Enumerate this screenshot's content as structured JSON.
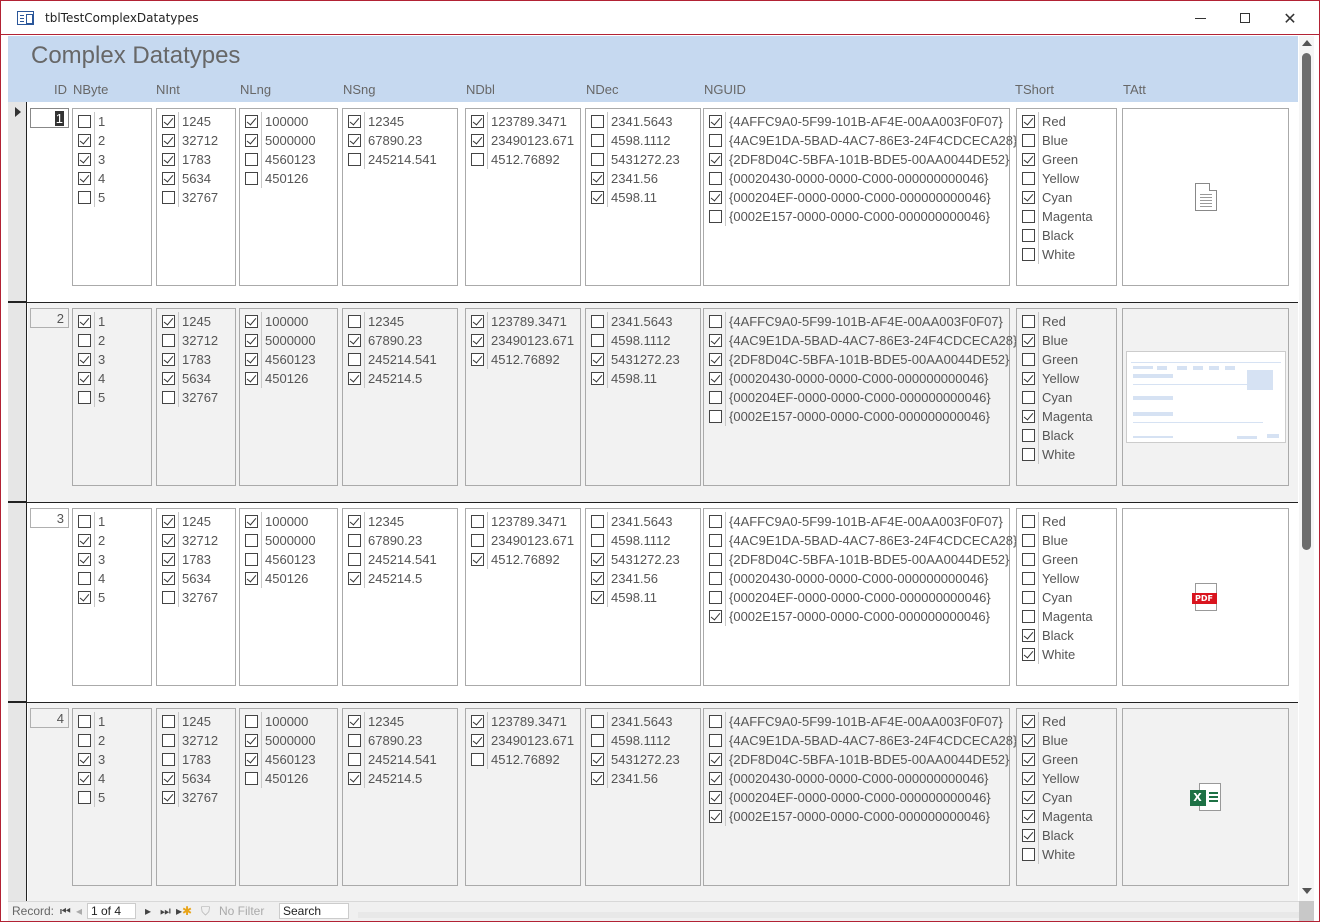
{
  "window": {
    "title": "tblTestComplexDatatypes",
    "controls": [
      "minimize",
      "maximize",
      "close"
    ]
  },
  "form": {
    "title": "Complex Datatypes",
    "columns": [
      "ID",
      "NByte",
      "NInt",
      "NLng",
      "NSng",
      "NDbl",
      "NDec",
      "NGUID",
      "TShort",
      "TAtt"
    ]
  },
  "records": [
    {
      "id": "1",
      "nbyte": [
        {
          "v": "1",
          "c": false
        },
        {
          "v": "2",
          "c": true
        },
        {
          "v": "3",
          "c": true
        },
        {
          "v": "4",
          "c": true
        },
        {
          "v": "5",
          "c": false
        }
      ],
      "nint": [
        {
          "v": "1245",
          "c": true
        },
        {
          "v": "32712",
          "c": true
        },
        {
          "v": "1783",
          "c": true
        },
        {
          "v": "5634",
          "c": true
        },
        {
          "v": "32767",
          "c": false
        }
      ],
      "nlng": [
        {
          "v": "100000",
          "c": true
        },
        {
          "v": "5000000",
          "c": true
        },
        {
          "v": "4560123",
          "c": false
        },
        {
          "v": "450126",
          "c": false
        }
      ],
      "nsng": [
        {
          "v": "12345",
          "c": true
        },
        {
          "v": "67890.23",
          "c": true
        },
        {
          "v": "245214.541",
          "c": false
        }
      ],
      "ndbl": [
        {
          "v": "123789.3471",
          "c": true
        },
        {
          "v": "23490123.671",
          "c": true
        },
        {
          "v": "4512.76892",
          "c": false
        }
      ],
      "ndec": [
        {
          "v": "2341.5643",
          "c": false
        },
        {
          "v": "4598.1112",
          "c": false
        },
        {
          "v": "5431272.23",
          "c": false
        },
        {
          "v": "2341.56",
          "c": true
        },
        {
          "v": "4598.11",
          "c": true
        }
      ],
      "nguid": [
        {
          "v": "{4AFFC9A0-5F99-101B-AF4E-00AA003F0F07}",
          "c": true
        },
        {
          "v": "{4AC9E1DA-5BAD-4AC7-86E3-24F4CDCECA28}",
          "c": false
        },
        {
          "v": "{2DF8D04C-5BFA-101B-BDE5-00AA0044DE52}",
          "c": true
        },
        {
          "v": "{00020430-0000-0000-C000-000000000046}",
          "c": false
        },
        {
          "v": "{000204EF-0000-0000-C000-000000000046}",
          "c": true
        },
        {
          "v": "{0002E157-0000-0000-C000-000000000046}",
          "c": false
        }
      ],
      "tshort": [
        {
          "v": "Red",
          "c": true
        },
        {
          "v": "Blue",
          "c": false
        },
        {
          "v": "Green",
          "c": true
        },
        {
          "v": "Yellow",
          "c": false
        },
        {
          "v": "Cyan",
          "c": true
        },
        {
          "v": "Magenta",
          "c": false
        },
        {
          "v": "Black",
          "c": false
        },
        {
          "v": "White",
          "c": false
        }
      ],
      "tatt": "generic-document-icon"
    },
    {
      "id": "2",
      "nbyte": [
        {
          "v": "1",
          "c": true
        },
        {
          "v": "2",
          "c": false
        },
        {
          "v": "3",
          "c": true
        },
        {
          "v": "4",
          "c": true
        },
        {
          "v": "5",
          "c": false
        }
      ],
      "nint": [
        {
          "v": "1245",
          "c": true
        },
        {
          "v": "32712",
          "c": false
        },
        {
          "v": "1783",
          "c": true
        },
        {
          "v": "5634",
          "c": true
        },
        {
          "v": "32767",
          "c": false
        }
      ],
      "nlng": [
        {
          "v": "100000",
          "c": true
        },
        {
          "v": "5000000",
          "c": true
        },
        {
          "v": "4560123",
          "c": true
        },
        {
          "v": "450126",
          "c": true
        }
      ],
      "nsng": [
        {
          "v": "12345",
          "c": false
        },
        {
          "v": "67890.23",
          "c": true
        },
        {
          "v": "245214.541",
          "c": false
        },
        {
          "v": "245214.5",
          "c": true
        }
      ],
      "ndbl": [
        {
          "v": "123789.3471",
          "c": true
        },
        {
          "v": "23490123.671",
          "c": true
        },
        {
          "v": "4512.76892",
          "c": true
        }
      ],
      "ndec": [
        {
          "v": "2341.5643",
          "c": false
        },
        {
          "v": "4598.1112",
          "c": false
        },
        {
          "v": "5431272.23",
          "c": true
        },
        {
          "v": "4598.11",
          "c": true
        }
      ],
      "nguid": [
        {
          "v": "{4AFFC9A0-5F99-101B-AF4E-00AA003F0F07}",
          "c": false
        },
        {
          "v": "{4AC9E1DA-5BAD-4AC7-86E3-24F4CDCECA28}",
          "c": true
        },
        {
          "v": "{2DF8D04C-5BFA-101B-BDE5-00AA0044DE52}",
          "c": true
        },
        {
          "v": "{00020430-0000-0000-C000-000000000046}",
          "c": true
        },
        {
          "v": "{000204EF-0000-0000-C000-000000000046}",
          "c": false
        },
        {
          "v": "{0002E157-0000-0000-C000-000000000046}",
          "c": false
        }
      ],
      "tshort": [
        {
          "v": "Red",
          "c": false
        },
        {
          "v": "Blue",
          "c": true
        },
        {
          "v": "Green",
          "c": false
        },
        {
          "v": "Yellow",
          "c": true
        },
        {
          "v": "Cyan",
          "c": false
        },
        {
          "v": "Magenta",
          "c": true
        },
        {
          "v": "Black",
          "c": false
        },
        {
          "v": "White",
          "c": false
        }
      ],
      "tatt": "screenshot-thumbnail"
    },
    {
      "id": "3",
      "nbyte": [
        {
          "v": "1",
          "c": false
        },
        {
          "v": "2",
          "c": true
        },
        {
          "v": "3",
          "c": true
        },
        {
          "v": "4",
          "c": false
        },
        {
          "v": "5",
          "c": true
        }
      ],
      "nint": [
        {
          "v": "1245",
          "c": true
        },
        {
          "v": "32712",
          "c": true
        },
        {
          "v": "1783",
          "c": true
        },
        {
          "v": "5634",
          "c": true
        },
        {
          "v": "32767",
          "c": false
        }
      ],
      "nlng": [
        {
          "v": "100000",
          "c": true
        },
        {
          "v": "5000000",
          "c": false
        },
        {
          "v": "4560123",
          "c": false
        },
        {
          "v": "450126",
          "c": true
        }
      ],
      "nsng": [
        {
          "v": "12345",
          "c": true
        },
        {
          "v": "67890.23",
          "c": false
        },
        {
          "v": "245214.541",
          "c": false
        },
        {
          "v": "245214.5",
          "c": true
        }
      ],
      "ndbl": [
        {
          "v": "123789.3471",
          "c": false
        },
        {
          "v": "23490123.671",
          "c": false
        },
        {
          "v": "4512.76892",
          "c": true
        }
      ],
      "ndec": [
        {
          "v": "2341.5643",
          "c": false
        },
        {
          "v": "4598.1112",
          "c": false
        },
        {
          "v": "5431272.23",
          "c": true
        },
        {
          "v": "2341.56",
          "c": true
        },
        {
          "v": "4598.11",
          "c": true
        }
      ],
      "nguid": [
        {
          "v": "{4AFFC9A0-5F99-101B-AF4E-00AA003F0F07}",
          "c": false
        },
        {
          "v": "{4AC9E1DA-5BAD-4AC7-86E3-24F4CDCECA28}",
          "c": false
        },
        {
          "v": "{2DF8D04C-5BFA-101B-BDE5-00AA0044DE52}",
          "c": false
        },
        {
          "v": "{00020430-0000-0000-C000-000000000046}",
          "c": false
        },
        {
          "v": "{000204EF-0000-0000-C000-000000000046}",
          "c": false
        },
        {
          "v": "{0002E157-0000-0000-C000-000000000046}",
          "c": true
        }
      ],
      "tshort": [
        {
          "v": "Red",
          "c": false
        },
        {
          "v": "Blue",
          "c": false
        },
        {
          "v": "Green",
          "c": false
        },
        {
          "v": "Yellow",
          "c": false
        },
        {
          "v": "Cyan",
          "c": false
        },
        {
          "v": "Magenta",
          "c": false
        },
        {
          "v": "Black",
          "c": true
        },
        {
          "v": "White",
          "c": true
        }
      ],
      "tatt": "pdf-icon",
      "tatt_label": "PDF"
    },
    {
      "id": "4",
      "nbyte": [
        {
          "v": "1",
          "c": false
        },
        {
          "v": "2",
          "c": false
        },
        {
          "v": "3",
          "c": true
        },
        {
          "v": "4",
          "c": true
        },
        {
          "v": "5",
          "c": false
        }
      ],
      "nint": [
        {
          "v": "1245",
          "c": false
        },
        {
          "v": "32712",
          "c": false
        },
        {
          "v": "1783",
          "c": false
        },
        {
          "v": "5634",
          "c": true
        },
        {
          "v": "32767",
          "c": true
        }
      ],
      "nlng": [
        {
          "v": "100000",
          "c": false
        },
        {
          "v": "5000000",
          "c": true
        },
        {
          "v": "4560123",
          "c": true
        },
        {
          "v": "450126",
          "c": false
        }
      ],
      "nsng": [
        {
          "v": "12345",
          "c": true
        },
        {
          "v": "67890.23",
          "c": false
        },
        {
          "v": "245214.541",
          "c": false
        },
        {
          "v": "245214.5",
          "c": true
        }
      ],
      "ndbl": [
        {
          "v": "123789.3471",
          "c": true
        },
        {
          "v": "23490123.671",
          "c": true
        },
        {
          "v": "4512.76892",
          "c": false
        }
      ],
      "ndec": [
        {
          "v": "2341.5643",
          "c": false
        },
        {
          "v": "4598.1112",
          "c": false
        },
        {
          "v": "5431272.23",
          "c": true
        },
        {
          "v": "2341.56",
          "c": true
        }
      ],
      "nguid": [
        {
          "v": "{4AFFC9A0-5F99-101B-AF4E-00AA003F0F07}",
          "c": false
        },
        {
          "v": "{4AC9E1DA-5BAD-4AC7-86E3-24F4CDCECA28}",
          "c": false
        },
        {
          "v": "{2DF8D04C-5BFA-101B-BDE5-00AA0044DE52}",
          "c": true
        },
        {
          "v": "{00020430-0000-0000-C000-000000000046}",
          "c": true
        },
        {
          "v": "{000204EF-0000-0000-C000-000000000046}",
          "c": true
        },
        {
          "v": "{0002E157-0000-0000-C000-000000000046}",
          "c": true
        }
      ],
      "tshort": [
        {
          "v": "Red",
          "c": true
        },
        {
          "v": "Blue",
          "c": true
        },
        {
          "v": "Green",
          "c": true
        },
        {
          "v": "Yellow",
          "c": true
        },
        {
          "v": "Cyan",
          "c": true
        },
        {
          "v": "Magenta",
          "c": true
        },
        {
          "v": "Black",
          "c": true
        },
        {
          "v": "White",
          "c": false
        }
      ],
      "tatt": "excel-icon",
      "tatt_label": "X"
    }
  ],
  "navigation": {
    "record_label": "Record:",
    "position": "1 of 4",
    "filter_label": "No Filter",
    "search_placeholder": "Search"
  },
  "colors": {
    "header_bg": "#c6d9f0",
    "window_border": "#b22234",
    "alt_row_bg": "#f2f2f2"
  }
}
